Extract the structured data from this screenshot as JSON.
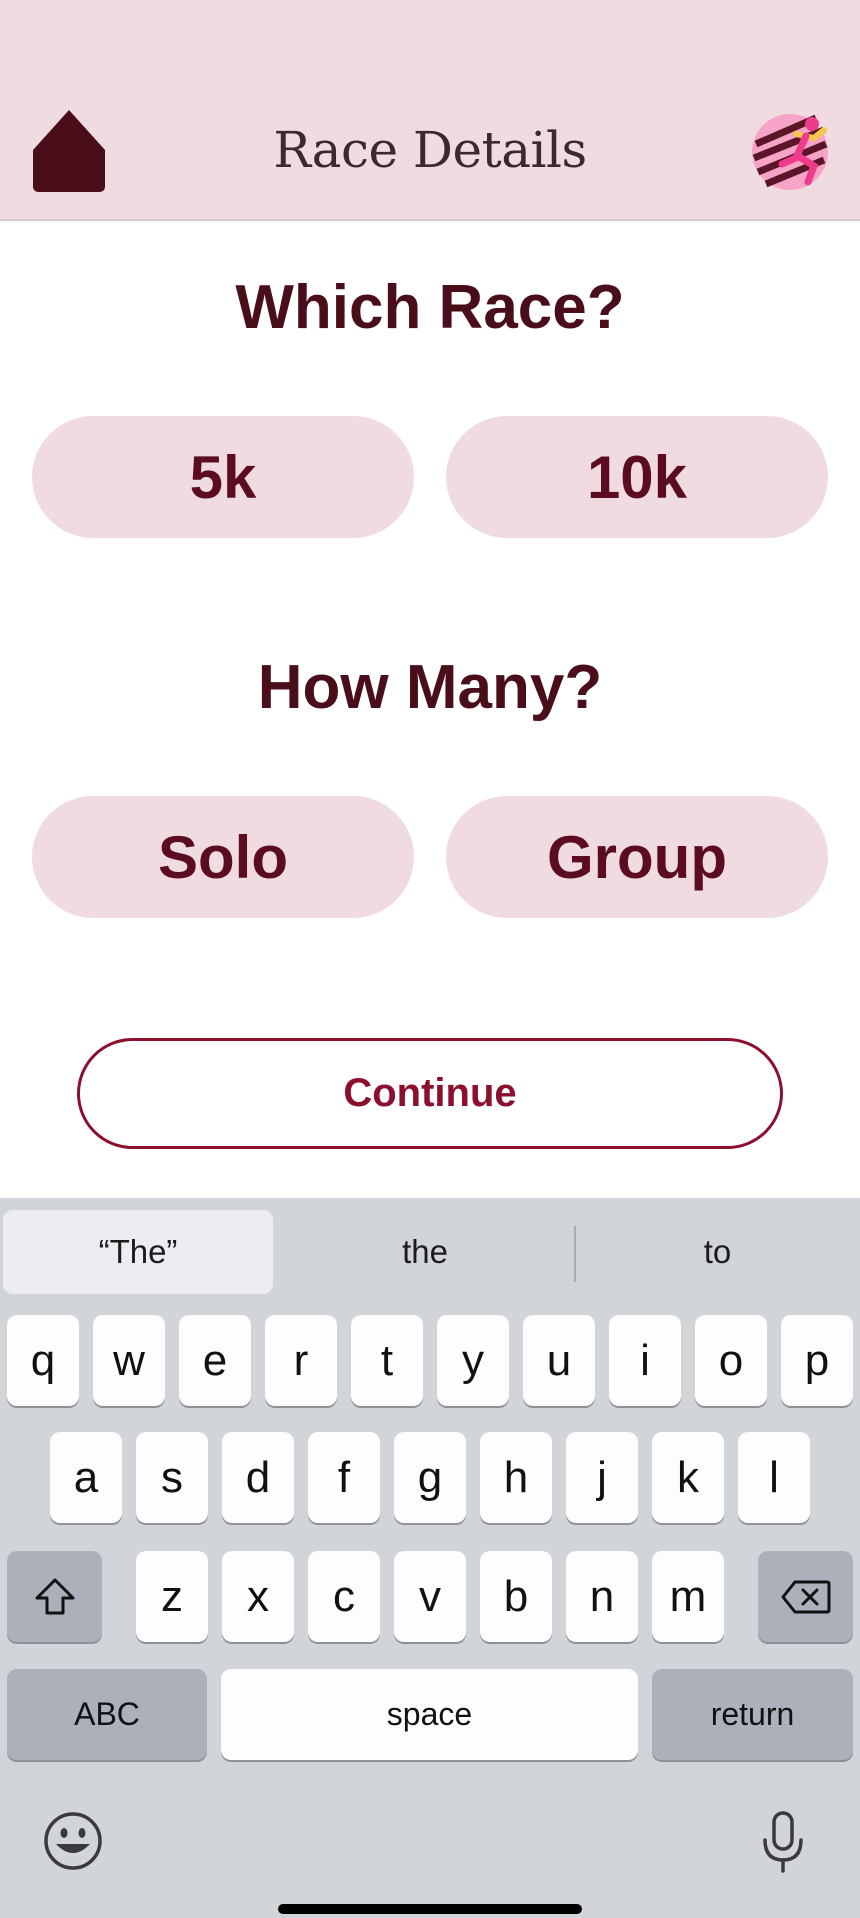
{
  "header": {
    "title": "Race Details",
    "icons": {
      "home": "home-icon",
      "logo": "runner-logo"
    }
  },
  "race_section": {
    "title": "Which Race?",
    "options": [
      "5k",
      "10k"
    ]
  },
  "count_section": {
    "title": "How Many?",
    "options": [
      "Solo",
      "Group"
    ]
  },
  "continue_label": "Continue",
  "keyboard": {
    "suggestions": [
      "“The”",
      "the",
      "to"
    ],
    "row1": [
      "q",
      "w",
      "e",
      "r",
      "t",
      "y",
      "u",
      "i",
      "o",
      "p"
    ],
    "row2": [
      "a",
      "s",
      "d",
      "f",
      "g",
      "h",
      "j",
      "k",
      "l"
    ],
    "row3": [
      "z",
      "x",
      "c",
      "v",
      "b",
      "n",
      "m"
    ],
    "abc_label": "ABC",
    "space_label": "space",
    "return_label": "return",
    "icons": {
      "shift": "shift-icon",
      "backspace": "backspace-icon",
      "emoji": "emoji-icon",
      "mic": "microphone-icon"
    }
  },
  "colors": {
    "header_bg": "#f0dbe0",
    "pill_bg": "#f0dbe0",
    "pill_text": "#5b0c20",
    "accent": "#8c0f2e",
    "keyboard_bg": "#d1d4d9"
  }
}
